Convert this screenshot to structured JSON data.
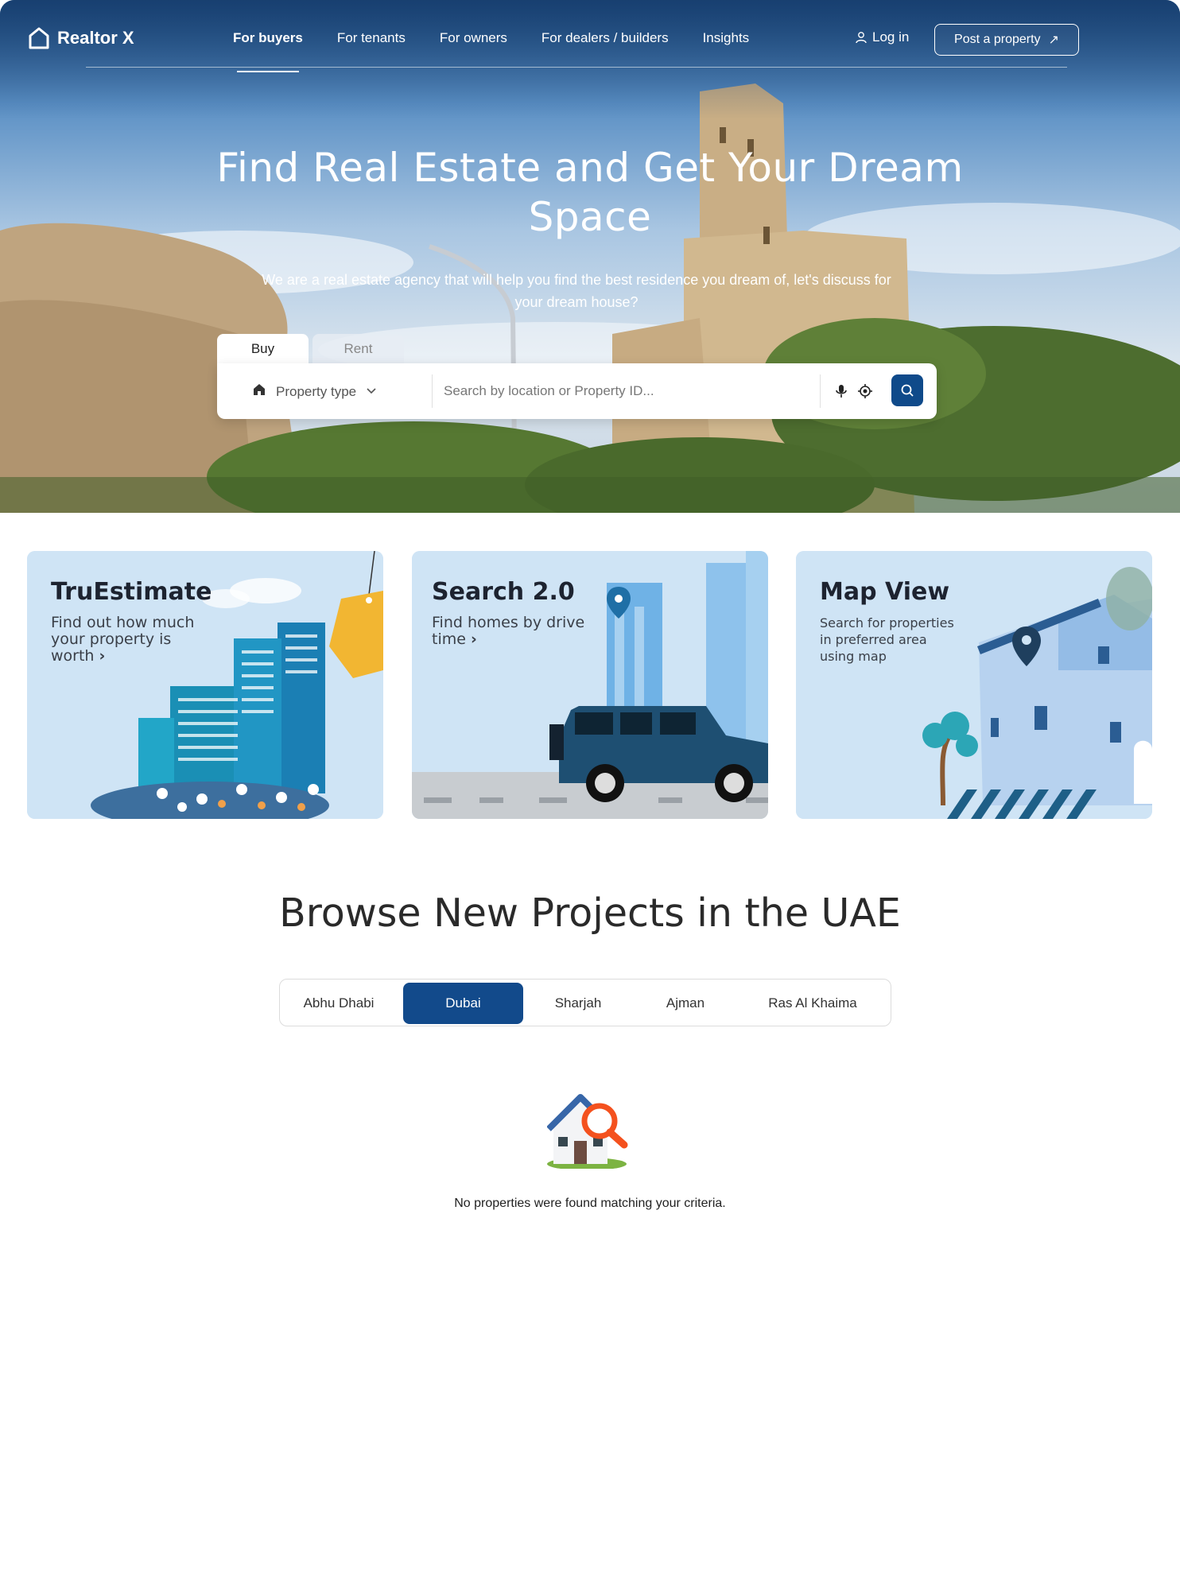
{
  "brand": {
    "name": "Realtor X"
  },
  "nav": {
    "links": [
      "For buyers",
      "For tenants",
      "For owners",
      "For dealers / builders",
      "Insights"
    ],
    "active": "For buyers",
    "login_label": "Log in",
    "post_label": "Post a property"
  },
  "hero": {
    "title": "Find Real Estate and Get Your Dream Space",
    "subtitle": "We are a real estate agency that will help you find the best residence you dream of, let's discuss for your dream house?"
  },
  "search": {
    "tabs": [
      "Buy",
      "Rent"
    ],
    "active_tab": "Buy",
    "property_type_label": "Property type",
    "placeholder": "Search by location or Property ID..."
  },
  "cards": [
    {
      "title": "TruEstimate",
      "description": "Find out how much your property is worth",
      "arrow": "›"
    },
    {
      "title": "Search 2.0",
      "description": "Find homes by drive time",
      "arrow": "›"
    },
    {
      "title": "Map View",
      "description": "Search for properties in preferred area using map"
    }
  ],
  "browse": {
    "title": "Browse New Projects in the UAE",
    "cities": [
      "Abhu Dhabi",
      "Dubai",
      "Sharjah",
      "Ajman",
      "Ras Al Khaima"
    ],
    "selected_city": "Dubai",
    "empty_message": "No properties were found matching your criteria."
  },
  "colors": {
    "primary": "#124a8b",
    "card_bg": "#cfe4f5"
  }
}
